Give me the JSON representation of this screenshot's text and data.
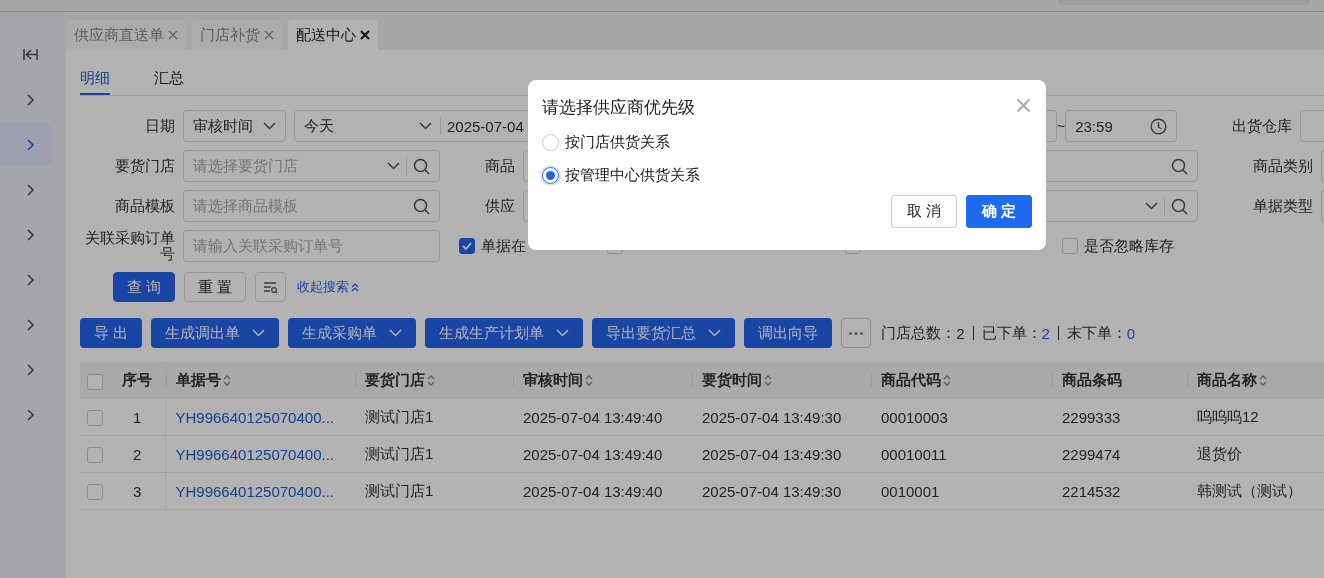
{
  "sidebar": {
    "items": [
      {
        "selected": false
      },
      {
        "selected": true
      },
      {
        "selected": false
      },
      {
        "selected": false
      },
      {
        "selected": false
      },
      {
        "selected": false
      },
      {
        "selected": false
      },
      {
        "selected": false
      }
    ]
  },
  "tabs": [
    {
      "label": "供应商直送单",
      "selected": false
    },
    {
      "label": "门店补货",
      "selected": false
    },
    {
      "label": "配送中心",
      "selected": true
    }
  ],
  "subtabs": [
    {
      "label": "明细",
      "selected": true
    },
    {
      "label": "汇总",
      "selected": false
    }
  ],
  "filters": {
    "date": {
      "label": "日期",
      "type": "审核时间",
      "preset": "今天",
      "start_date": "2025-07-04",
      "separator": "~",
      "end_time": "23:59",
      "right_label": "出货仓库"
    },
    "rows": [
      {
        "label": "要货门店",
        "placeholder": "请选择要货门店",
        "dropdown": true,
        "mid_label": "商品",
        "mid_dropdown": false,
        "right_label": "商品类别"
      },
      {
        "label": "商品模板",
        "placeholder": "请选择商品模板",
        "dropdown": false,
        "mid_label": "供应",
        "mid_dropdown": true,
        "right_label": "单据类型"
      }
    ],
    "order": {
      "label": "关联采购订单号",
      "placeholder": "请输入关联采购订单号"
    },
    "checkboxes": [
      {
        "label": "单据在",
        "checked": true
      },
      {
        "checked": false
      },
      {
        "checked": false
      },
      {
        "label": "是否忽略库存",
        "checked": false
      }
    ]
  },
  "search_buttons": [
    {
      "label": "查 询",
      "kind": "primary"
    },
    {
      "label": "重 置",
      "kind": "default"
    }
  ],
  "collapse_link": "收起搜索",
  "toolbar": [
    {
      "label": "导 出",
      "dropdown": false
    },
    {
      "label": "生成调出单",
      "dropdown": true
    },
    {
      "label": "生成采购单",
      "dropdown": true
    },
    {
      "label": "生成生产计划单",
      "dropdown": true
    },
    {
      "label": "导出要货汇总",
      "dropdown": true
    },
    {
      "label": "调出向导",
      "dropdown": false
    }
  ],
  "stats": [
    {
      "label": "门店总数：",
      "value": "2",
      "highlight": false
    },
    {
      "label": "已下单：",
      "value": "2",
      "highlight": true
    },
    {
      "label": "末下单：",
      "value": "0",
      "highlight": true
    }
  ],
  "table": {
    "header_checked": false,
    "columns": [
      {
        "label": "序号",
        "sortable": false
      },
      {
        "label": "单据号",
        "sortable": true
      },
      {
        "label": "要货门店",
        "sortable": true
      },
      {
        "label": "审核时间",
        "sortable": true
      },
      {
        "label": "要货时间",
        "sortable": true
      },
      {
        "label": "商品代码",
        "sortable": true
      },
      {
        "label": "商品条码",
        "sortable": false
      },
      {
        "label": "商品名称",
        "sortable": true
      }
    ],
    "rows": [
      {
        "checked": false,
        "cells": [
          "1",
          "YH996640125070400...",
          "测试门店1",
          "2025-07-04 13:49:40",
          "2025-07-04 13:49:30",
          "00010003",
          "2299333",
          "呜呜呜12"
        ]
      },
      {
        "checked": false,
        "cells": [
          "2",
          "YH996640125070400...",
          "测试门店1",
          "2025-07-04 13:49:40",
          "2025-07-04 13:49:30",
          "00010011",
          "2299474",
          "退货价"
        ]
      },
      {
        "checked": false,
        "cells": [
          "3",
          "YH996640125070400...",
          "测试门店1",
          "2025-07-04 13:49:40",
          "2025-07-04 13:49:30",
          "0010001",
          "2214532",
          "韩测试（测试）"
        ]
      }
    ]
  },
  "modal": {
    "title": "请选择供应商优先级",
    "options": [
      {
        "label": "按门店供货关系",
        "selected": false
      },
      {
        "label": "按管理中心供货关系",
        "selected": true
      }
    ],
    "buttons": [
      {
        "label": "取 消",
        "kind": "default"
      },
      {
        "label": "确 定",
        "kind": "primary"
      }
    ]
  }
}
